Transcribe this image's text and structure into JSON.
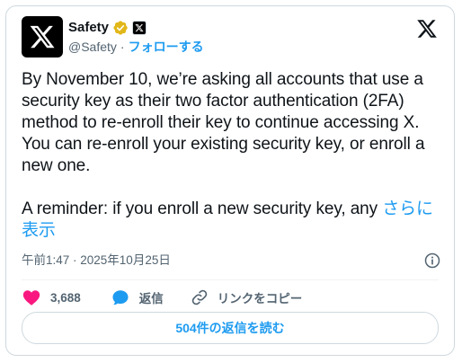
{
  "author": {
    "display_name": "Safety",
    "handle": "@Safety",
    "separator": "·",
    "follow_label": "フォローする"
  },
  "tweet": {
    "paragraph_1": "By November 10, we’re asking all accounts that use a security key as their two factor authentication (2FA) method to re-enroll their key to continue accessing X. You can re-enroll your existing security key, or enroll a new one.",
    "paragraph_2": "A reminder: if you enroll a new security key, any ",
    "show_more": "さらに表示",
    "timestamp": "午前1:47 · 2025年10月25日"
  },
  "actions": {
    "like_count": "3,688",
    "reply_label": "返信",
    "copy_link_label": "リンクをコピー"
  },
  "read_replies_label": "504件の返信を読む",
  "colors": {
    "accent": "#1d9bf0",
    "like": "#f91880",
    "verified": "#e2b719",
    "text": "#0f1419",
    "muted": "#536471"
  },
  "icons": [
    "x-logo-icon",
    "verified-badge-icon",
    "affiliate-x-icon",
    "info-icon",
    "heart-icon",
    "reply-bubble-icon",
    "link-icon"
  ]
}
